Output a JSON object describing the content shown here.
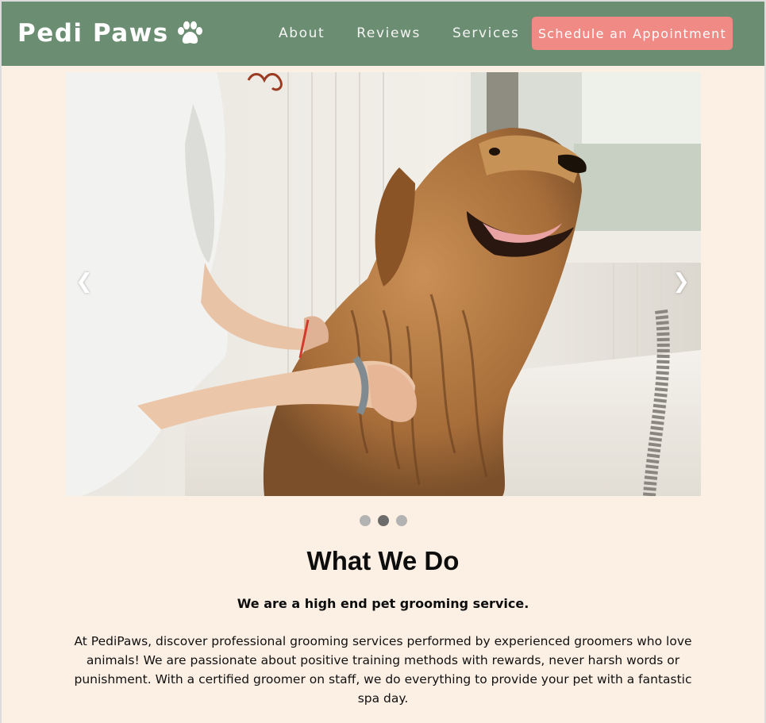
{
  "brand": {
    "name": "Pedi Paws",
    "icon": "paw-icon",
    "navbar_color": "#6b8e72",
    "accent_color": "#f08a84",
    "page_background": "#fcefe4"
  },
  "nav": {
    "links": [
      {
        "label": "About"
      },
      {
        "label": "Reviews"
      },
      {
        "label": "Services"
      }
    ],
    "cta_label": "Schedule an Appointment"
  },
  "carousel": {
    "prev_icon": "❮",
    "next_icon": "❯",
    "slide_count": 3,
    "active_index": 1
  },
  "about": {
    "title": "What We Do",
    "tagline": "We are a high end pet grooming service.",
    "description": "At PediPaws, discover professional grooming services performed by experienced groomers who love animals! We are passionate about positive training methods with rewards, never harsh words or punishment. With a certified groomer on staff, we do everything to provide your pet with a fantastic spa day."
  }
}
